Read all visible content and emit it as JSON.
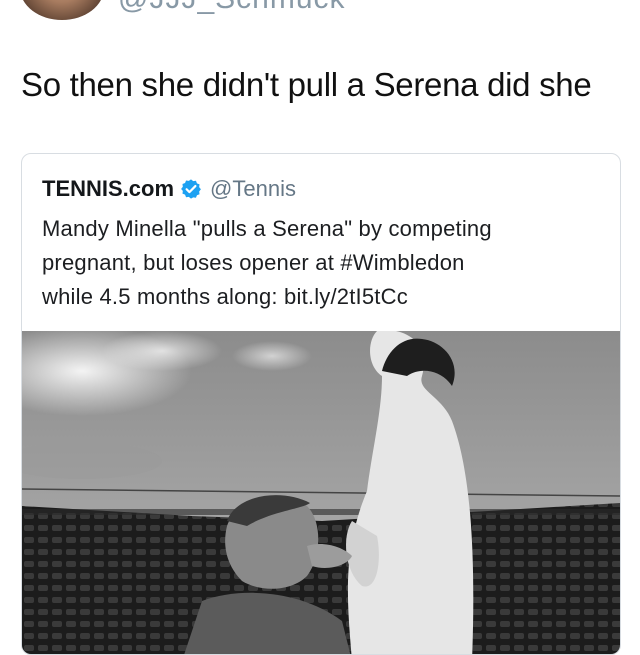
{
  "author": {
    "handle": "@JJJ_Schmuck"
  },
  "tweet": {
    "text": "So then she didn't pull a Serena did she"
  },
  "quoted": {
    "name": "TENNIS.com",
    "handle": "@Tennis",
    "verified": true,
    "lines": [
      "Mandy Minella \"pulls a Serena\" by competing",
      "pregnant, but loses opener at #Wimbledon",
      "while 4.5 months along: bit.ly/2tI5tCc"
    ]
  },
  "colors": {
    "verified_badge": "#1da1f2",
    "border": "#d8dde2"
  },
  "icons": {
    "verified": "verified-badge-icon"
  }
}
